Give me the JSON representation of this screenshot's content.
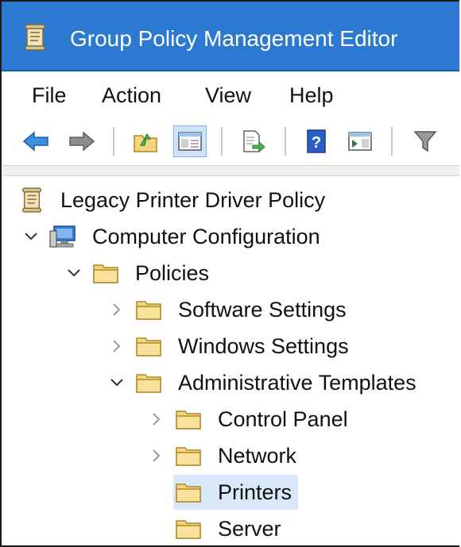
{
  "window": {
    "title": "Group Policy Management Editor"
  },
  "menu": [
    "File",
    "Action",
    "View",
    "Help"
  ],
  "toolbar": {
    "buttons": [
      "back-icon",
      "forward-icon",
      "up-folder-icon",
      "show-hide-tree-icon",
      "export-list-icon",
      "help-icon",
      "show-action-pane-icon",
      "filter-icon"
    ]
  },
  "tree": {
    "root": "Legacy Printer Driver Policy",
    "computer_configuration": "Computer Configuration",
    "policies": "Policies",
    "software_settings": "Software Settings",
    "windows_settings": "Windows Settings",
    "administrative_templates": "Administrative Templates",
    "control_panel": "Control Panel",
    "network": "Network",
    "printers": "Printers",
    "server": "Server",
    "selected": "Printers"
  },
  "colors": {
    "titlebar": "#2b79d0",
    "selection": "#d9e8f8",
    "folder": "#f4d57c"
  }
}
